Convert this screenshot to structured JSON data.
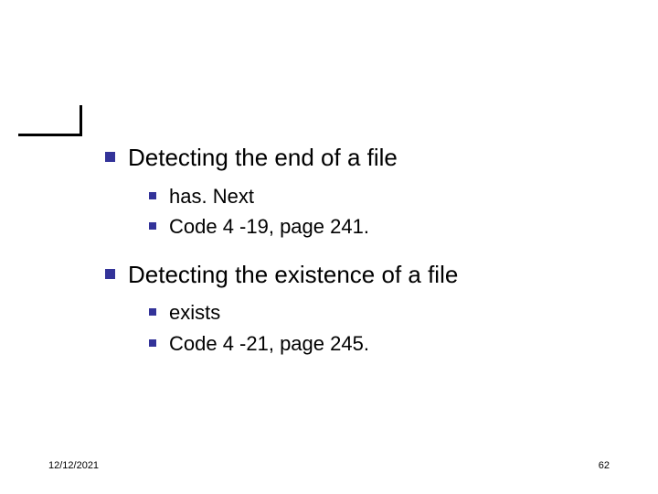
{
  "headings": {
    "h1": "Detecting the end of a file",
    "h2": "Detecting the existence of a file"
  },
  "section1": {
    "item1": "has. Next",
    "item2": "Code 4 -19, page 241."
  },
  "section2": {
    "item1": "exists",
    "item2": "Code 4 -21, page 245."
  },
  "footer": {
    "date": "12/12/2021",
    "page": "62"
  }
}
